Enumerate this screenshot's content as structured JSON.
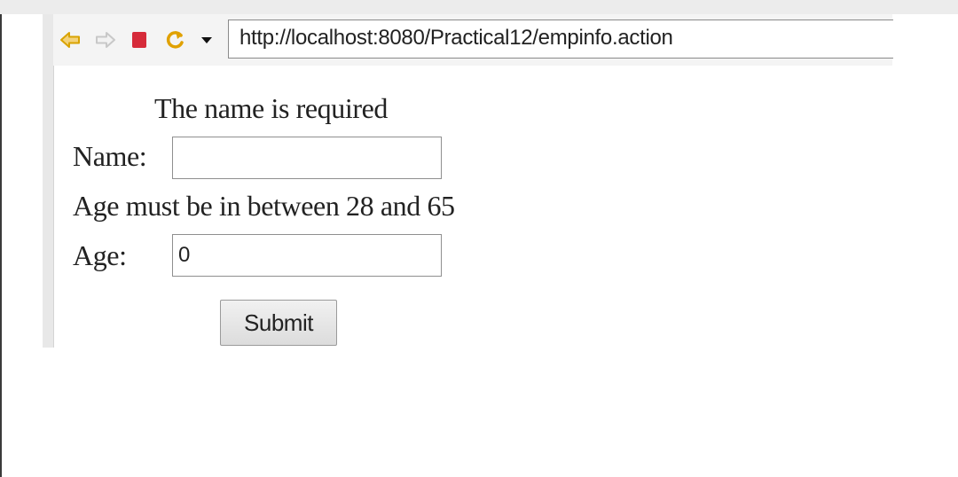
{
  "browser": {
    "url": "http://localhost:8080/Practical12/empinfo.action",
    "toolbar_icons": [
      "back-arrow-icon",
      "forward-arrow-icon",
      "stop-icon",
      "refresh-icon",
      "dropdown-icon"
    ],
    "icon_colors": {
      "back": "#e8b400",
      "forward": "#cfcfcf",
      "stop": "#d62b3a",
      "refresh": "#e0a100"
    }
  },
  "form": {
    "name_error": "The name is required",
    "name_label": "Name:",
    "name_value": "",
    "age_error": "Age must be in between 28 and 65",
    "age_label": "Age:",
    "age_value": "0",
    "submit_label": "Submit"
  }
}
